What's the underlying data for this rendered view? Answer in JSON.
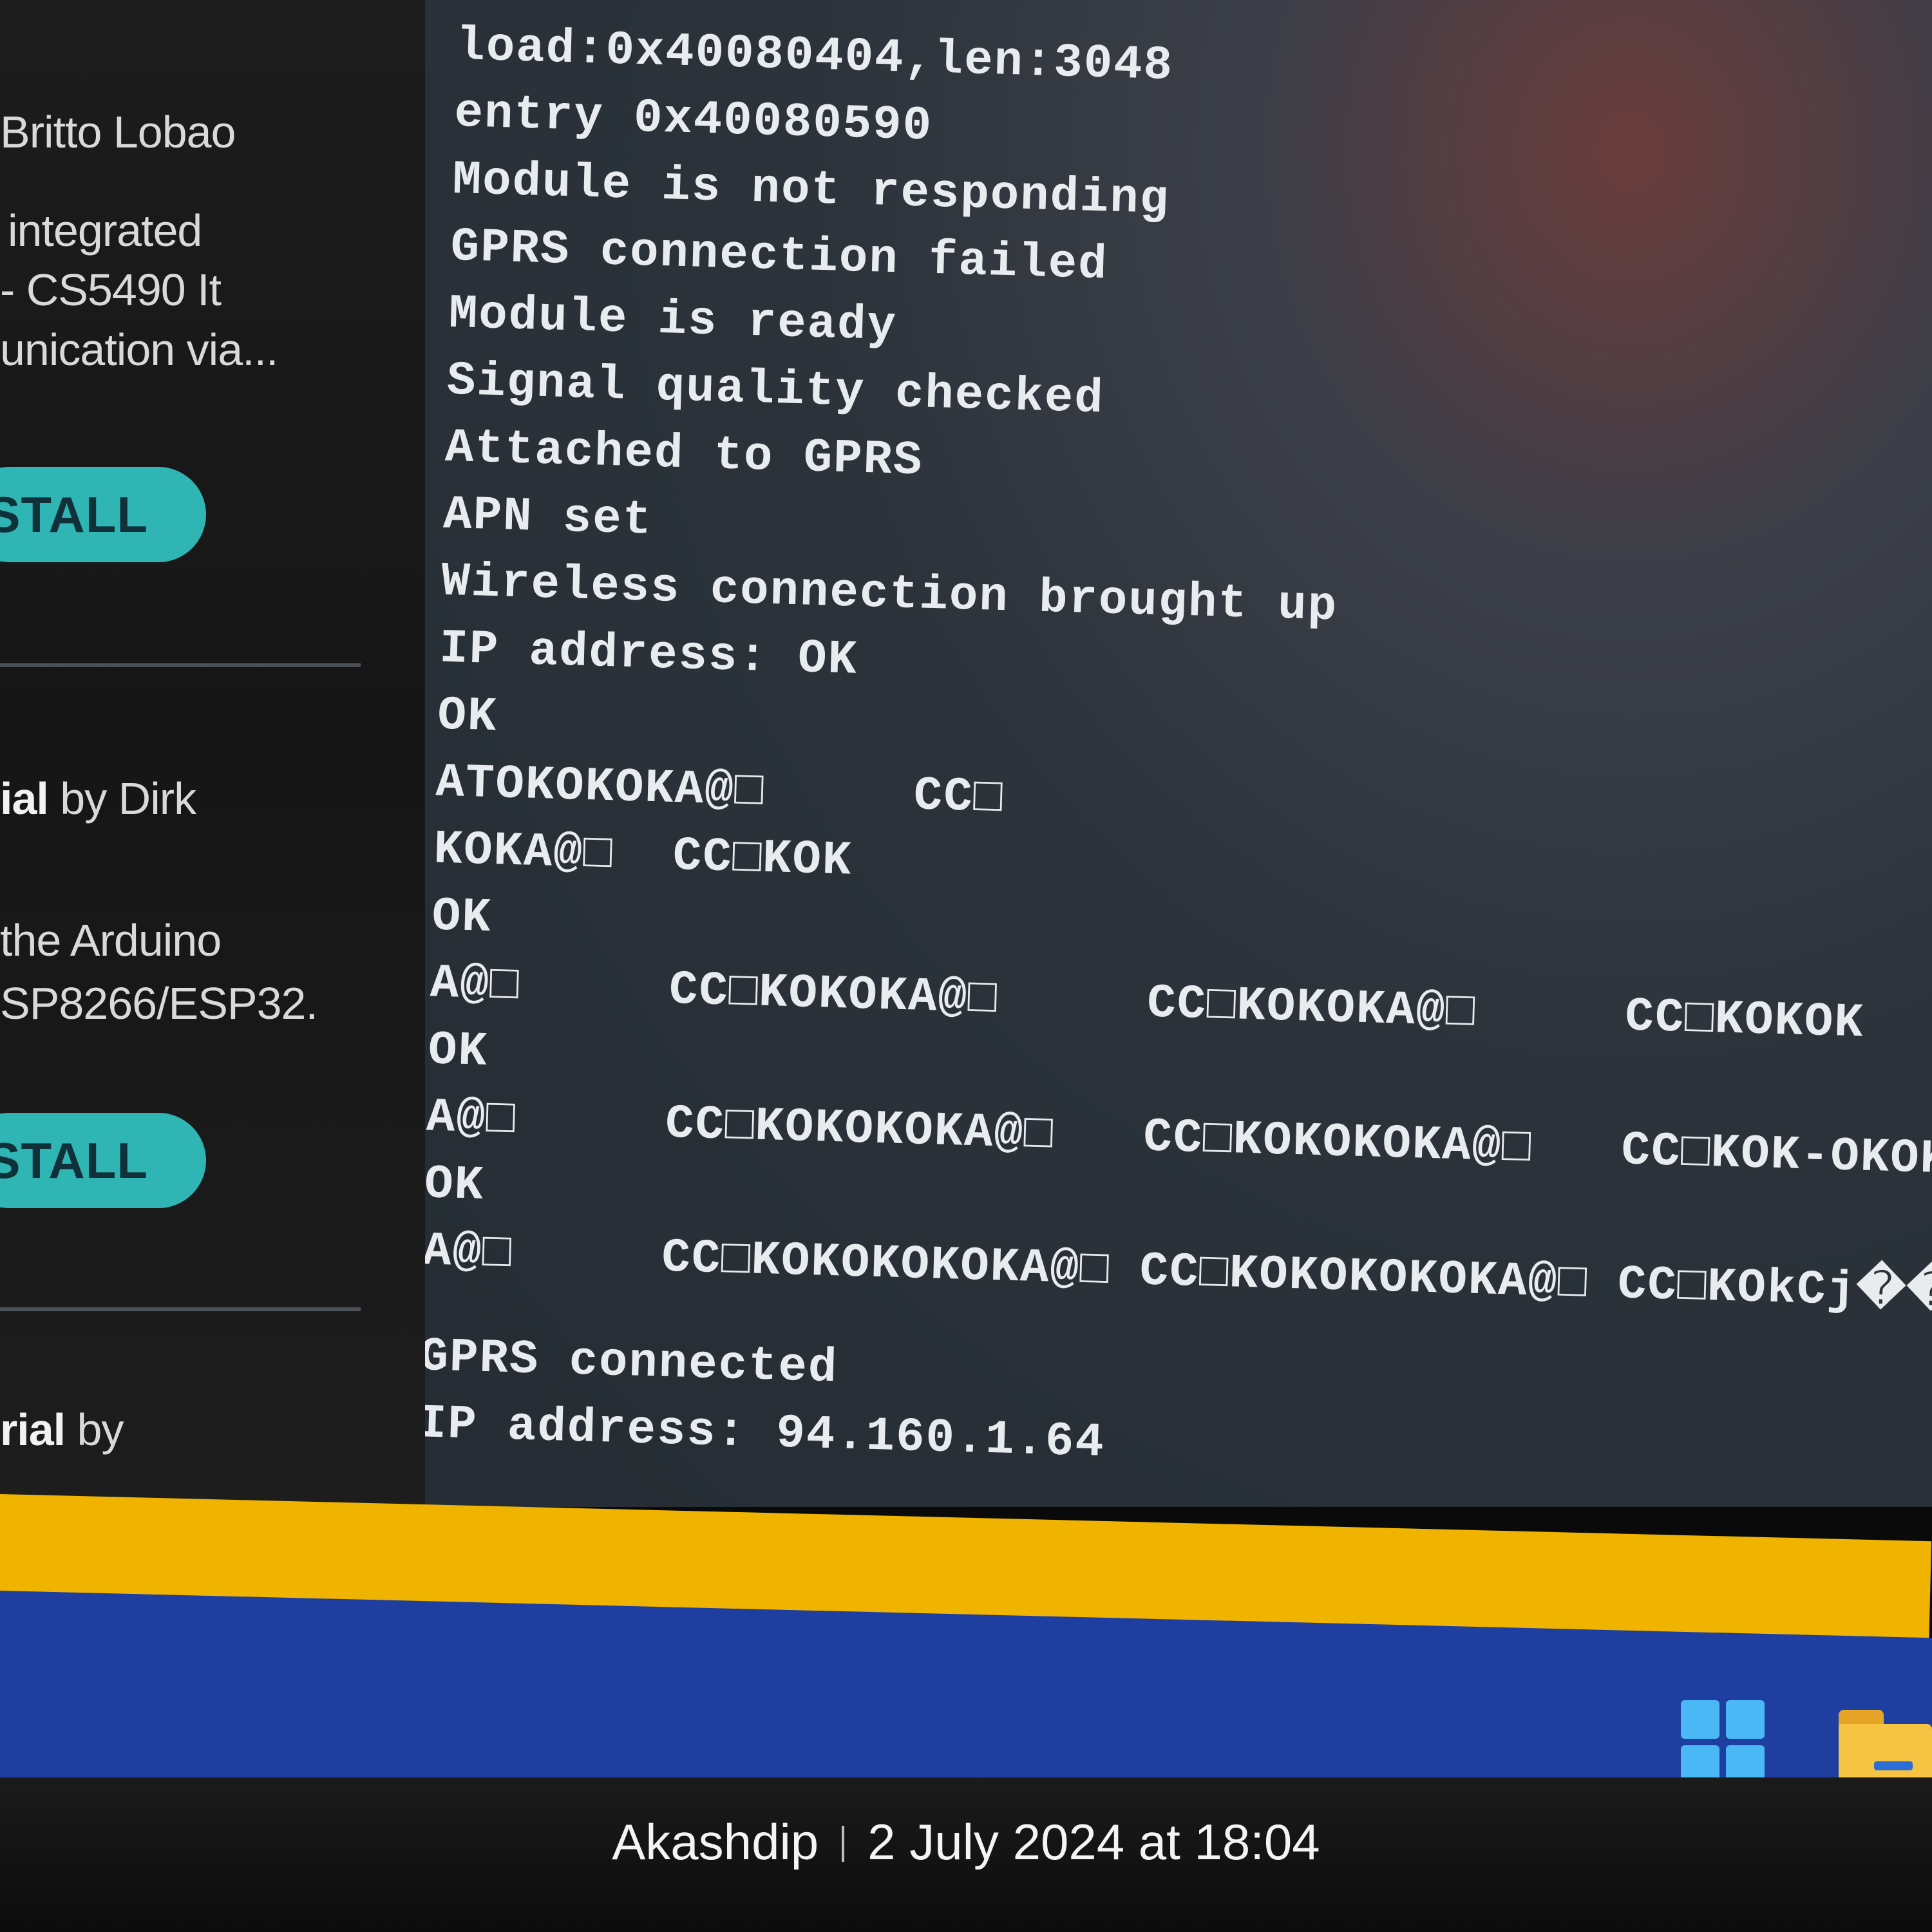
{
  "sidebar": {
    "lines": [
      {
        "text": "Britto Lobao"
      },
      {
        "text": "integrated"
      },
      {
        "text": "- CS5490 It"
      },
      {
        "text": "unication via..."
      }
    ],
    "install_label": "STALL",
    "library2": {
      "title_bold": "ial",
      "title_rest": " by Dirk",
      "desc": [
        "the Arduino",
        "SP8266/ESP32."
      ],
      "install_label": "STALL"
    },
    "library3": {
      "title_bold": "rial",
      "title_rest": " by"
    }
  },
  "serial_monitor": {
    "lines": [
      "load:0x40080404,len:3048",
      "entry 0x40080590",
      "Module is not responding",
      "GPRS connection failed",
      "Module is ready",
      "Signal quality checked",
      "Attached to GPRS",
      "APN set",
      "Wireless connection brought up",
      "IP address: OK",
      "OK",
      "ATOKOKOKA@□     CC□",
      "KOKA@□  CC□KOK",
      "OK",
      "A@□     CC□KOKOKA@□     CC□KOKOKA@□     CC□KOKOK",
      "OK",
      "A@□     CC□KOKOKOKA@□   CC□KOKOKOKA@□   CC□KOK-OKOKA",
      "OK",
      "A@□     CC□KOKOKOKOKA@□ CC□KOKOKOKOKA@□ CC□KOkCj���",
      "",
      "GPRS connected",
      "IP address: 94.160.1.64"
    ]
  },
  "taskbar": {
    "icons": [
      "windows-start-icon",
      "file-explorer-icon"
    ]
  },
  "photo_caption": {
    "author": "Akashdip",
    "datetime": "2 July 2024 at 18:04"
  },
  "colors": {
    "install_button": "#2fb6b4",
    "taskbar": "#1f3fa0",
    "monitor_text": "#e9ecef"
  }
}
